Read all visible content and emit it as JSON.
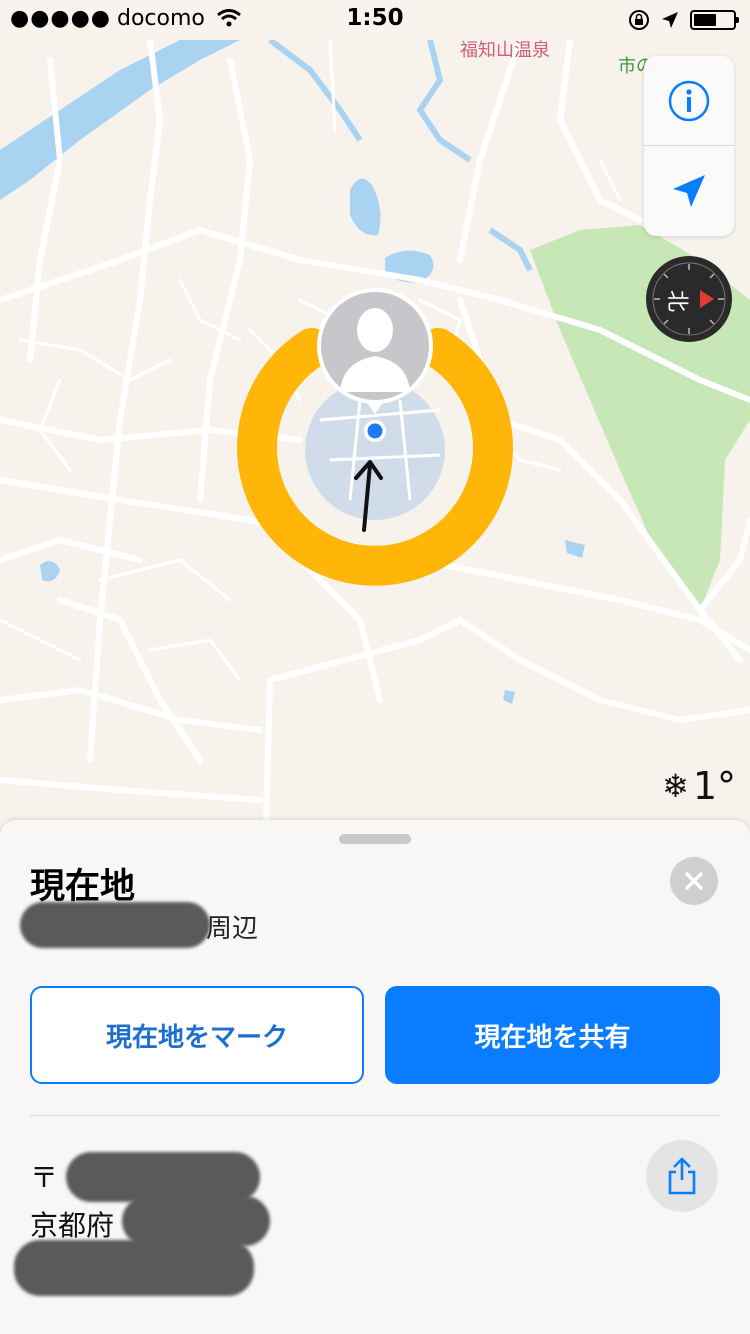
{
  "status_bar": {
    "signal_dots": "●●●●●",
    "carrier": "docomo",
    "time": "1:50"
  },
  "map": {
    "poi_label_1": "福知山温泉",
    "poi_label_2": "市の",
    "avatar_kind": "default-person-silhouette",
    "weather": {
      "icon": "snowflake-icon",
      "temperature": "1°"
    }
  },
  "controls": {
    "info_icon": "info-icon",
    "location_icon": "location-arrow-icon"
  },
  "compass": {
    "label": "北"
  },
  "sheet": {
    "title": "現在地",
    "subtitle_suffix": "周辺",
    "buttons": {
      "mark_label": "現在地をマーク",
      "share_label": "現在地を共有"
    },
    "address": {
      "postal_prefix": "〒",
      "prefecture": "京都府"
    }
  },
  "colors": {
    "accent": "#0a7cff",
    "ring": "#ffb400",
    "park": "#c7e7b6",
    "water": "#a9d3f1"
  }
}
